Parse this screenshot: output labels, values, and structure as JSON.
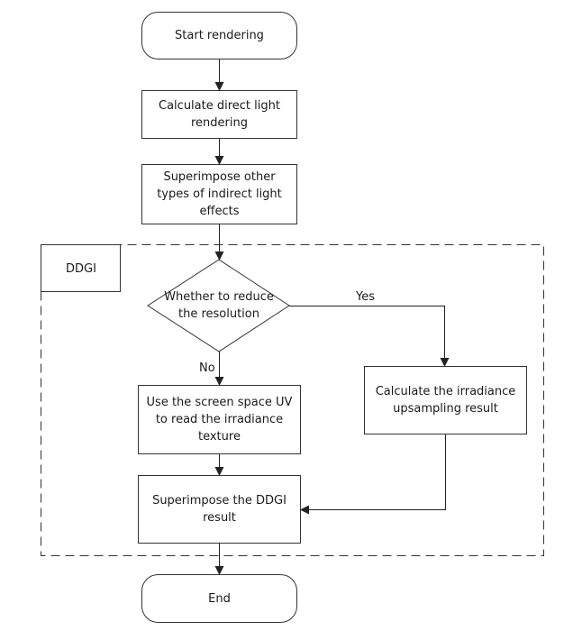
{
  "diagram": {
    "type": "flowchart",
    "nodes": {
      "start": {
        "shape": "terminator",
        "label": "Start rendering"
      },
      "direct_light": {
        "shape": "process",
        "label": "Calculate direct light\nrendering"
      },
      "indirect_light": {
        "shape": "process",
        "label": "Superimpose other\ntypes of indirect light\neffects"
      },
      "ddgi_group": {
        "shape": "group",
        "label": "DDGI"
      },
      "decision": {
        "shape": "decision",
        "label": "Whether to reduce\nthe resolution"
      },
      "read_texture": {
        "shape": "process",
        "label": "Use the screen space UV\nto read the irradiance\ntexture"
      },
      "upsampling": {
        "shape": "process",
        "label": "Calculate the irradiance\nupsampling result"
      },
      "superimpose_ddgi": {
        "shape": "process",
        "label": "Superimpose the DDGI\nresult"
      },
      "end": {
        "shape": "terminator",
        "label": "End"
      }
    },
    "edges": [
      {
        "from": "start",
        "to": "direct_light",
        "label": ""
      },
      {
        "from": "direct_light",
        "to": "indirect_light",
        "label": ""
      },
      {
        "from": "indirect_light",
        "to": "decision",
        "label": ""
      },
      {
        "from": "decision",
        "to": "upsampling",
        "label": "Yes"
      },
      {
        "from": "decision",
        "to": "read_texture",
        "label": "No"
      },
      {
        "from": "read_texture",
        "to": "superimpose_ddgi",
        "label": ""
      },
      {
        "from": "upsampling",
        "to": "superimpose_ddgi",
        "label": ""
      },
      {
        "from": "superimpose_ddgi",
        "to": "end",
        "label": ""
      }
    ],
    "edge_labels": {
      "yes": "Yes",
      "no": "No"
    },
    "colors": {
      "stroke": "#333333",
      "text": "#1a1a1a",
      "background": "#ffffff"
    }
  }
}
